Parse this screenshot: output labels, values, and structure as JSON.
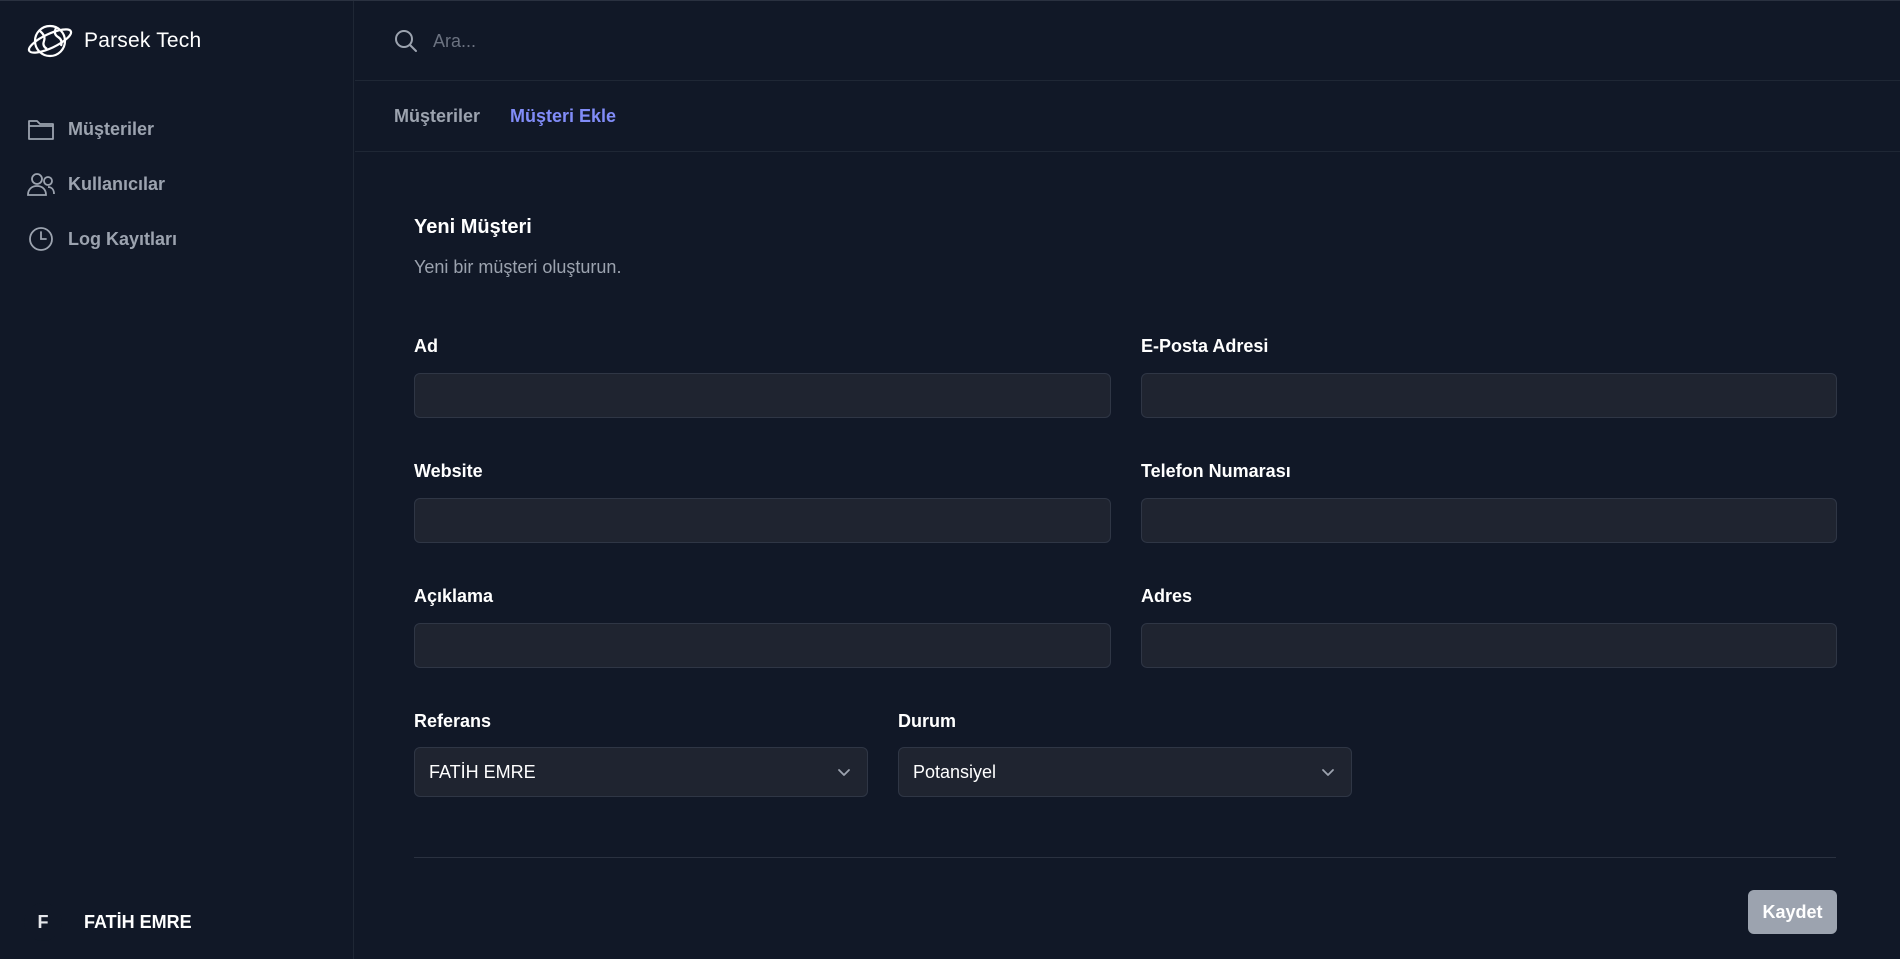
{
  "brand": {
    "name": "Parsek Tech",
    "logo_icon": "planet-globe-icon"
  },
  "sidebar": {
    "items": [
      {
        "label": "Müşteriler",
        "icon": "folder-icon"
      },
      {
        "label": "Kullanıcılar",
        "icon": "users-icon"
      },
      {
        "label": "Log Kayıtları",
        "icon": "clock-icon"
      }
    ],
    "user": {
      "initial": "F",
      "name": "FATİH EMRE"
    }
  },
  "search": {
    "placeholder": "Ara...",
    "value": ""
  },
  "tabs": [
    {
      "label": "Müşteriler",
      "active": false
    },
    {
      "label": "Müşteri Ekle",
      "active": true
    }
  ],
  "form": {
    "title": "Yeni Müşteri",
    "description": "Yeni bir müşteri oluşturun.",
    "fields": {
      "name": {
        "label": "Ad",
        "value": ""
      },
      "email": {
        "label": "E-Posta Adresi",
        "value": ""
      },
      "website": {
        "label": "Website",
        "value": ""
      },
      "phone": {
        "label": "Telefon Numarası",
        "value": ""
      },
      "description": {
        "label": "Açıklama",
        "value": ""
      },
      "address": {
        "label": "Adres",
        "value": ""
      },
      "reference": {
        "label": "Referans",
        "value": "FATİH EMRE"
      },
      "status": {
        "label": "Durum",
        "value": "Potansiyel"
      }
    },
    "save_label": "Kaydet"
  },
  "colors": {
    "background": "#111827",
    "input_bg": "#1f2430",
    "accent": "#818cf8",
    "muted_text": "#9ca3af",
    "save_button": "#9ca3af"
  }
}
